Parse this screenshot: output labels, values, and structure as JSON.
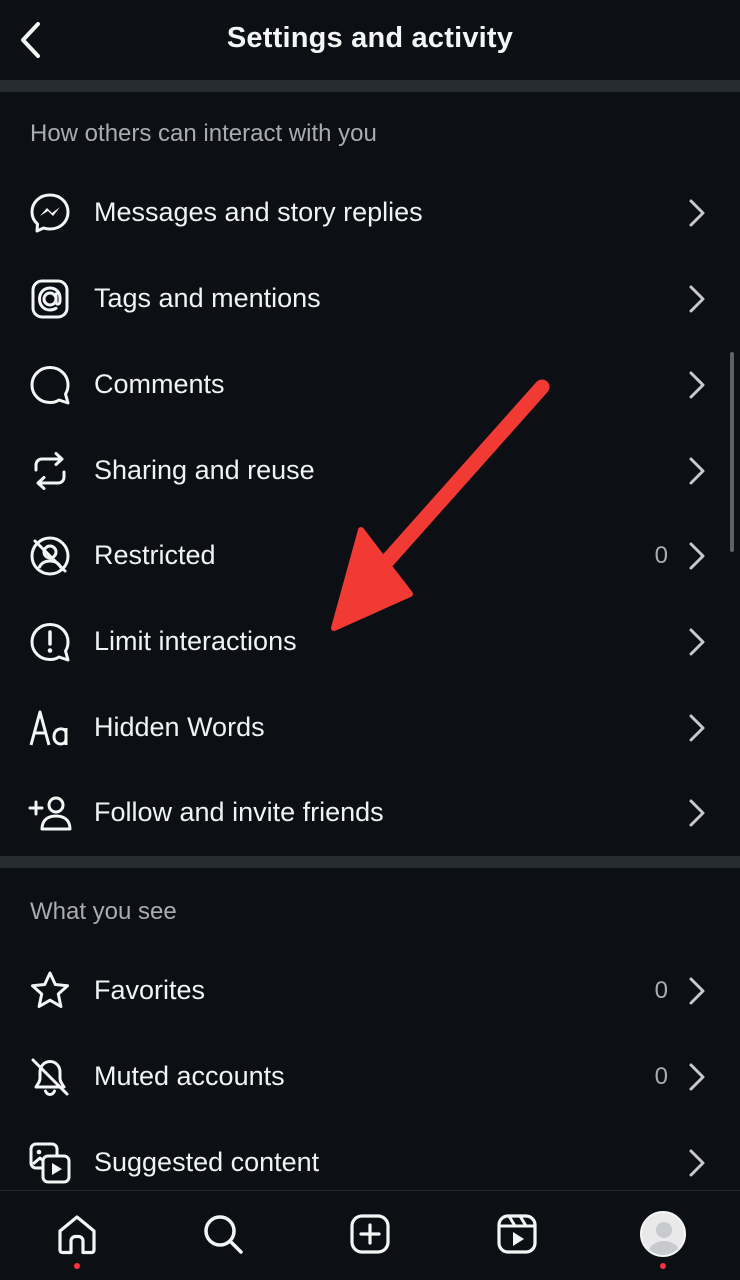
{
  "header": {
    "title": "Settings and activity"
  },
  "sections": [
    {
      "title": "How others can interact with you",
      "items": [
        {
          "label": "Messages and story replies",
          "icon": "messenger-icon"
        },
        {
          "label": "Tags and mentions",
          "icon": "at-sign-icon"
        },
        {
          "label": "Comments",
          "icon": "comment-icon"
        },
        {
          "label": "Sharing and reuse",
          "icon": "repost-icon"
        },
        {
          "label": "Restricted",
          "icon": "restricted-icon",
          "count": "0"
        },
        {
          "label": "Limit interactions",
          "icon": "limit-interactions-icon"
        },
        {
          "label": "Hidden Words",
          "icon": "text-aa-icon"
        },
        {
          "label": "Follow and invite friends",
          "icon": "add-person-icon"
        }
      ]
    },
    {
      "title": "What you see",
      "items": [
        {
          "label": "Favorites",
          "icon": "star-icon",
          "count": "0"
        },
        {
          "label": "Muted accounts",
          "icon": "muted-bell-icon",
          "count": "0"
        },
        {
          "label": "Suggested content",
          "icon": "suggested-content-icon"
        }
      ]
    }
  ],
  "annotation": {
    "color": "#f23a35",
    "target": "Limit interactions"
  },
  "tabbar": {
    "tabs": [
      "home-icon",
      "search-icon",
      "create-icon",
      "reels-icon",
      "profile-avatar"
    ],
    "notification_color": "#ff3040"
  }
}
